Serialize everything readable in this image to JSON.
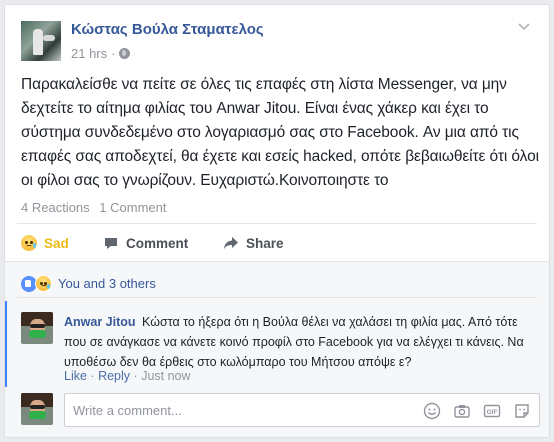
{
  "post": {
    "author": "Κώστας Βούλα Σταματελος",
    "time": "21 hrs",
    "separator": "·",
    "text": "Παρακαλείσθε να πείτε σε όλες τις επαφές στη λίστα Messenger, να μην δεχτείτε το αίτημα φιλίας του Anwar Jitou. Είναι ένας χάκερ και έχει το σύστημα συνδεδεμένο στο λογαριασμό σας στο Facebook. Αν μια από τις επαφές σας αποδεχτεί, θα έχετε και εσείς hacked, οπότε βεβαιωθείτε ότι όλοι οι φίλοι σας το γνωρίζουν. Ευχαριστώ.Κοινοποιηστε το",
    "reactions_count": "4 Reactions",
    "comments_count": "1 Comment"
  },
  "actions": {
    "sad": "Sad",
    "comment": "Comment",
    "share": "Share"
  },
  "reactions_summary": {
    "text": "You and 3 others"
  },
  "comment": {
    "author": "Anwar Jitou",
    "text": "Κώστα το ήξερα ότι η Βούλα θέλει να χαλάσει τη φιλία μας. Από τότε που σε ανάγκασε να κάνετε κοινό προφίλ στο Facebook για να ελέγχει τι κάνεις. Να υποθέσω δεν θα έρθεις στο κωλόμπαρο του Μήτσου απόψε ε?",
    "like": "Like",
    "reply": "Reply",
    "time": "Just now",
    "dot": "·"
  },
  "composer": {
    "placeholder": "Write a comment..."
  },
  "icons": {
    "privacy": "globe-icon",
    "menu": "chevron-down-icon",
    "emoji": "smiley-icon",
    "camera": "camera-icon",
    "gif": "gif-icon",
    "sticker": "sticker-icon"
  },
  "colors": {
    "link": "#365899",
    "sad": "#f0ba15",
    "like": "#5890ff",
    "comment_accent": "#4080ff"
  }
}
